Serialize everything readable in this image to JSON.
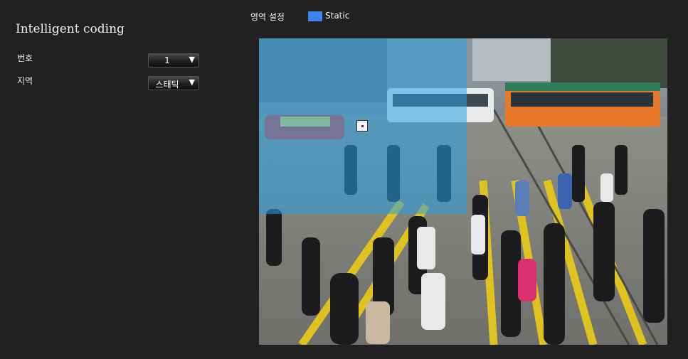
{
  "panel": {
    "title": "Intelligent coding",
    "fields": [
      {
        "label": "번호",
        "value": "1"
      },
      {
        "label": "지역",
        "value": "스태틱"
      }
    ]
  },
  "legend": {
    "title": "영역 설정",
    "items": [
      {
        "label": "Static",
        "color": "#3a85f0"
      }
    ]
  },
  "zone": {
    "color": "#28a0e1",
    "opacity": 0.55
  }
}
